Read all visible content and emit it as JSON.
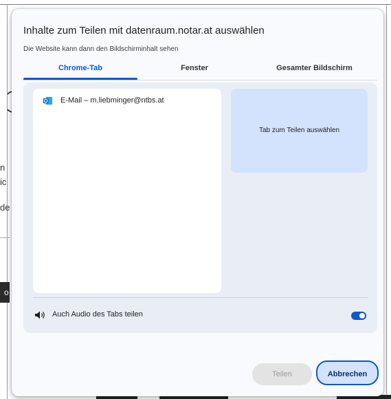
{
  "background": {
    "fragments": [
      "(",
      "n",
      "ic",
      "de",
      "o"
    ]
  },
  "dialog": {
    "title": "Inhalte zum Teilen mit datenraum.notar.at auswählen",
    "subtitle": "Die Website kann dann den Bildschirminhalt sehen",
    "tabs": [
      {
        "label": "Chrome-Tab",
        "active": true
      },
      {
        "label": "Fenster",
        "active": false
      },
      {
        "label": "Gesamter Bildschirm",
        "active": false
      }
    ],
    "tab_list": [
      {
        "label": "E-Mail – m.liebminger@ntbs.at",
        "icon": "outlook-icon"
      }
    ],
    "preview_text": "Tab zum Teilen auswählen",
    "audio": {
      "label": "Auch Audio des Tabs teilen",
      "enabled": true,
      "icon": "speaker-icon"
    },
    "buttons": {
      "share": "Teilen",
      "cancel": "Abbrechen"
    }
  },
  "colors": {
    "accent": "#0b57d0",
    "preview_bg": "#d3e3fd",
    "panel_bg": "#e9eef6"
  }
}
